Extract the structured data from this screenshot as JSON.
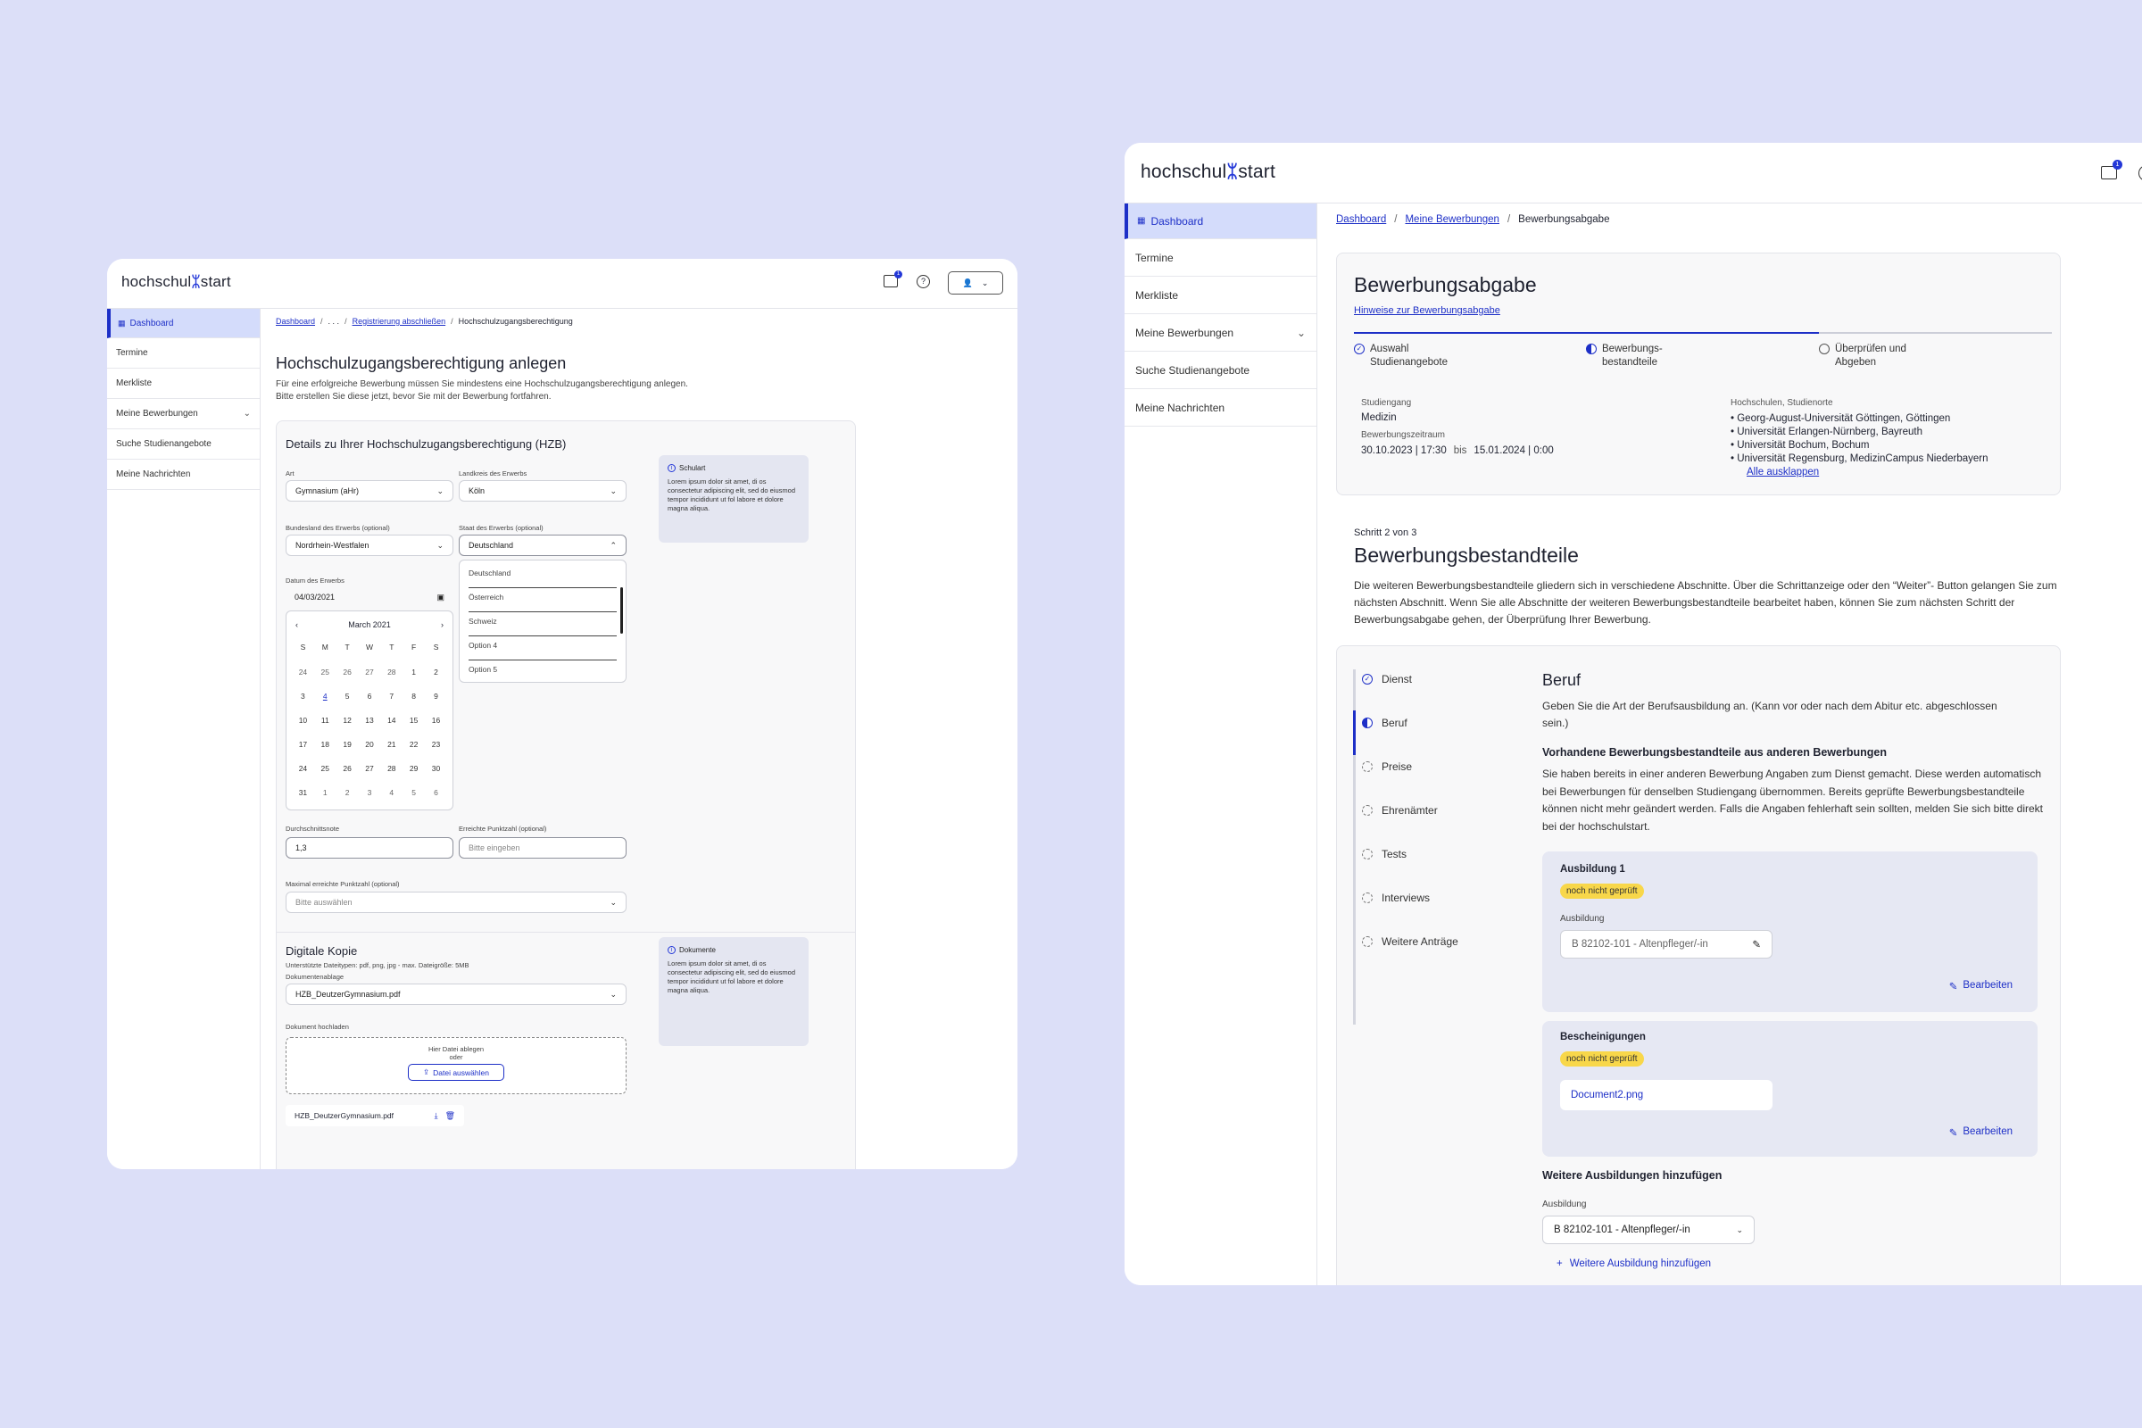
{
  "left": {
    "logo": "hochschul",
    "logo_tail": "start",
    "header": {
      "notification_count": "1"
    },
    "sidebar": [
      {
        "label": "Dashboard"
      },
      {
        "label": "Termine"
      },
      {
        "label": "Merkliste"
      },
      {
        "label": "Meine Bewerbungen"
      },
      {
        "label": "Suche Studienangebote"
      },
      {
        "label": "Meine Nachrichten"
      }
    ],
    "breadcrumb": {
      "dashboard": "Dashboard",
      "ellipsis": ". . .",
      "registration": "Registrierung abschließen",
      "current": "Hochschulzugangsberechtigung"
    },
    "page_title": "Hochschulzugangsberechtigung anlegen",
    "intro_line1": "Für eine erfolgreiche Bewerbung müssen Sie mindestens eine Hochschulzugangsberechtigung anlegen.",
    "intro_line2": "Bitte erstellen Sie diese jetzt, bevor Sie mit der Bewerbung fortfahren.",
    "section_title": "Details zu Ihrer Hochschulzugangsberechtigung (HZB)",
    "art": {
      "label": "Art",
      "value": "Gymnasium (aHr)"
    },
    "landkreis": {
      "label": "Landkreis des Erwerbs",
      "value": "Köln"
    },
    "bundesland": {
      "label": "Bundesland des Erwerbs (optional)",
      "value": "Nordrhein-Westfalen"
    },
    "staat": {
      "label": "Staat des Erwerbs (optional)",
      "value": "Deutschland",
      "options": [
        "Deutschland",
        "Österreich",
        "Schweiz",
        "Option 4",
        "Option 5"
      ]
    },
    "datum": {
      "label": "Datum des Erwerbs",
      "value": "04/03/2021"
    },
    "calendar": {
      "month": "March  2021",
      "weekdays": [
        "S",
        "M",
        "T",
        "W",
        "T",
        "F",
        "S"
      ],
      "weeks": [
        [
          "24",
          "25",
          "26",
          "27",
          "28",
          "1",
          "2"
        ],
        [
          "3",
          "4",
          "5",
          "6",
          "7",
          "8",
          "9"
        ],
        [
          "10",
          "11",
          "12",
          "13",
          "14",
          "15",
          "16"
        ],
        [
          "17",
          "18",
          "19",
          "20",
          "21",
          "22",
          "23"
        ],
        [
          "24",
          "25",
          "26",
          "27",
          "28",
          "29",
          "30"
        ],
        [
          "31",
          "1",
          "2",
          "3",
          "4",
          "5",
          "6"
        ]
      ]
    },
    "durchschnitt": {
      "label": "Durchschnittsnote",
      "value": "1,3"
    },
    "punktzahl": {
      "label": "Erreichte Punktzahl (optional)",
      "placeholder": "Bitte eingeben"
    },
    "max_punktzahl": {
      "label": "Maximal erreichte Punktzahl (optional)",
      "placeholder": "Bitte auswählen"
    },
    "info_schulart": {
      "title": "Schulart",
      "text": "Lorem ipsum dolor sit amet, di os consectetur adipiscing elit, sed do eiusmod tempor incididunt ut fol labore et dolore magna aliqua."
    },
    "digital": {
      "title": "Digitale Kopie",
      "hint": "Unterstützte Dateitypen: pdf, png, jpg - max. Dateigröße: 5MB",
      "ablage_label": "Dokumentenablage",
      "ablage_value": "HZB_DeutzerGymnasium.pdf",
      "upload_label": "Dokument hochladen",
      "drop_text": "Hier Datei ablegen",
      "oder": "oder",
      "choose_button": "Datei auswählen",
      "file_name": "HZB_DeutzerGymnasium.pdf"
    },
    "info_dokumente": {
      "title": "Dokumente",
      "text": "Lorem ipsum dolor sit amet, di os consectetur adipiscing elit, sed do eiusmod tempor incididunt ut fol labore et dolore magna aliqua."
    }
  },
  "right": {
    "logo": "hochschul",
    "logo_tail": "start",
    "header": {
      "notification_count": "1"
    },
    "sidebar": [
      {
        "label": "Dashboard"
      },
      {
        "label": "Termine"
      },
      {
        "label": "Merkliste"
      },
      {
        "label": "Meine Bewerbungen"
      },
      {
        "label": "Suche Studienangebote"
      },
      {
        "label": "Meine Nachrichten"
      }
    ],
    "breadcrumb": {
      "dashboard": "Dashboard",
      "bewerbungen": "Meine Bewerbungen",
      "current": "Bewerbungsabgabe"
    },
    "summary": {
      "title": "Bewerbungsabgabe",
      "hint_link": "Hinweise zur Bewerbungsabgabe",
      "steps": [
        {
          "line1": "Auswahl",
          "line2": "Studienangebote"
        },
        {
          "line1": "Bewerbungs-",
          "line2": "bestandteile"
        },
        {
          "line1": "Überprüfen und",
          "line2": "Abgeben"
        }
      ],
      "studiengang_label": "Studiengang",
      "studiengang_value": "Medizin",
      "zeitraum_label": "Bewerbungszeitraum",
      "zeitraum_from": "30.10.2023 | 17:30",
      "zeitraum_bis": "bis",
      "zeitraum_to": "15.01.2024 | 0:00",
      "hochschulen_label": "Hochschulen, Studienorte",
      "hochschulen": [
        "Georg-August-Universität Göttingen, Göttingen",
        "Universität Erlangen-Nürnberg, Bayreuth",
        "Universität Bochum, Bochum",
        "Universität Regensburg, MedizinCampus Niederbayern"
      ],
      "expand_link": "Alle ausklappen"
    },
    "step_label": "Schritt 2 von 3",
    "section_title": "Bewerbungsbestandteile",
    "section_text": "Die weiteren Bewerbungsbestandteile gliedern sich in verschiedene Abschnitte. Über die Schrittanzeige oder den “Weiter”- Button gelangen Sie zum nächsten Abschnitt. Wenn Sie alle Abschnitte der weiteren Bewerbungsbestandteile bearbeitet haben, können Sie zum nächsten Schritt der Bewerbungsabgabe gehen, der Überprüfung Ihrer Bewerbung.",
    "vnav": [
      {
        "label": "Dienst"
      },
      {
        "label": "Beruf"
      },
      {
        "label": "Preise"
      },
      {
        "label": "Ehrenämter"
      },
      {
        "label": "Tests"
      },
      {
        "label": "Interviews"
      },
      {
        "label": "Weitere Anträge"
      }
    ],
    "beruf": {
      "title": "Beruf",
      "text": "Geben Sie die Art der Berufsausbildung an. (Kann vor oder nach dem Abitur etc. abgeschlossen sein.)",
      "existing_title": "Vorhandene Bewerbungsbestandteile aus anderen Bewerbungen",
      "existing_text": "Sie haben bereits in einer anderen Bewerbung Angaben zum Dienst gemacht. Diese werden automatisch bei Bewerbungen für denselben Studiengang übernommen. Bereits geprüfte Bewerbungsbestandteile können nicht mehr geändert werden. Falls die Angaben fehlerhaft sein sollten, melden Sie sich bitte direkt bei der hochschulstart.",
      "ausbildung_card": {
        "title": "Ausbildung 1",
        "badge": "noch nicht geprüft",
        "field_label": "Ausbildung",
        "field_value": "B 82102-101 - Altenpfleger/-in",
        "edit": "Bearbeiten"
      },
      "bescheinigung_card": {
        "title": "Bescheinigungen",
        "badge": "noch nicht geprüft",
        "file": "Document2.png",
        "edit": "Bearbeiten"
      },
      "more_title": "Weitere Ausbildungen hinzufügen",
      "more_label": "Ausbildung",
      "more_value": "B 82102-101 - Altenpfleger/-in",
      "add_link": "Weitere Ausbildung hinzufügen"
    }
  }
}
